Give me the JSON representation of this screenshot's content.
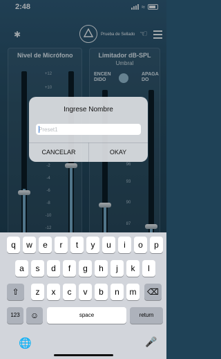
{
  "status": {
    "time": "2:48"
  },
  "header": {
    "logo_label": "Prueba de Sellado"
  },
  "left_panel": {
    "title": "Nivel de Micrófono",
    "scale": [
      "+12",
      "+10",
      "+8",
      "+6",
      "+4",
      "+2",
      "0",
      "-2",
      "-4",
      "-6",
      "-8",
      "-10",
      "-12"
    ]
  },
  "right_panel": {
    "title": "Limitador dB-SPL",
    "subtitle": "Umbral",
    "toggle_on": "ENCEN\nDIDO",
    "toggle_off": "APAGA\nDO",
    "scale": [
      "96",
      "93",
      "90",
      "87"
    ]
  },
  "dialog": {
    "title": "Ingrese Nombre",
    "input_placeholder": "Preset1",
    "input_value": "",
    "cancel_label": "CANCELAR",
    "ok_label": "OKAY"
  },
  "keyboard": {
    "row1": [
      "q",
      "w",
      "e",
      "r",
      "t",
      "y",
      "u",
      "i",
      "o",
      "p"
    ],
    "row2": [
      "a",
      "s",
      "d",
      "f",
      "g",
      "h",
      "j",
      "k",
      "l"
    ],
    "row3": [
      "z",
      "x",
      "c",
      "v",
      "b",
      "n",
      "m"
    ],
    "numbers_key": "123",
    "space_key": "space",
    "return_key": "return"
  }
}
